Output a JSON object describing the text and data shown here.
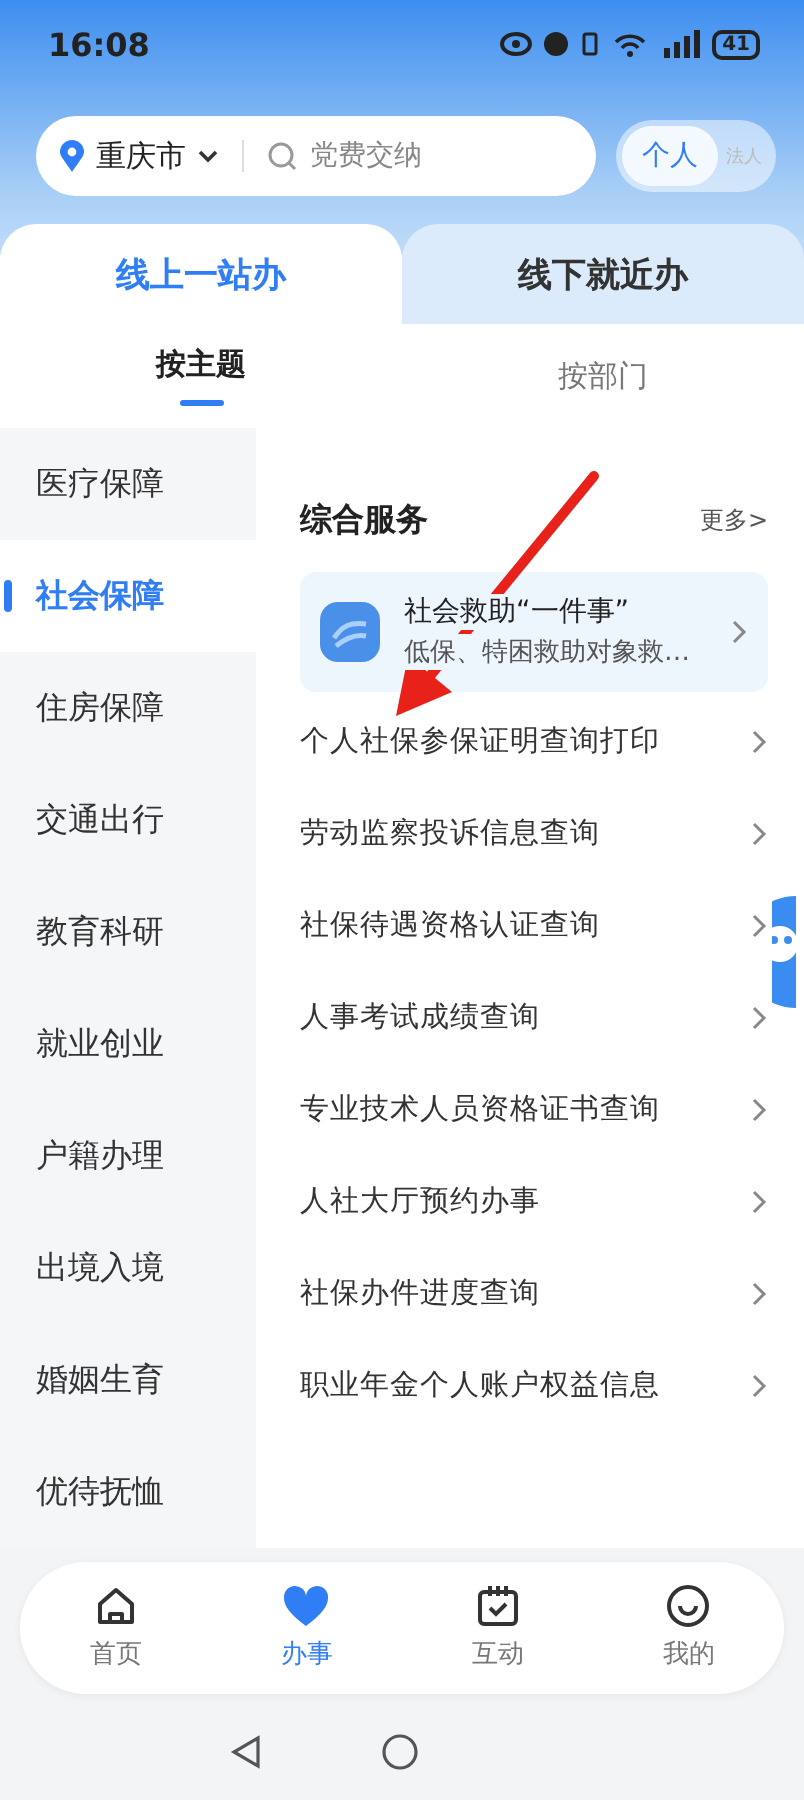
{
  "status_bar": {
    "time": "16:08",
    "battery": "41"
  },
  "search_bar": {
    "city": "重庆市",
    "placeholder": "党费交纳"
  },
  "identity_toggle": [
    {
      "label": "个人",
      "selected": true
    },
    {
      "label": "法人",
      "selected": false
    }
  ],
  "tabs": [
    {
      "label": "线上一站办",
      "selected": true
    },
    {
      "label": "线下就近办",
      "selected": false
    }
  ],
  "sub_tabs": [
    {
      "label": "按主题",
      "selected": true
    },
    {
      "label": "按部门",
      "selected": false
    }
  ],
  "sidebar": {
    "items": [
      {
        "label": "医疗保障",
        "selected": false
      },
      {
        "label": "社会保障",
        "selected": true
      },
      {
        "label": "住房保障",
        "selected": false
      },
      {
        "label": "交通出行",
        "selected": false
      },
      {
        "label": "教育科研",
        "selected": false
      },
      {
        "label": "就业创业",
        "selected": false
      },
      {
        "label": "户籍办理",
        "selected": false
      },
      {
        "label": "出境入境",
        "selected": false
      },
      {
        "label": "婚姻生育",
        "selected": false
      },
      {
        "label": "优待抚恤",
        "selected": false
      }
    ]
  },
  "section": {
    "title": "综合服务",
    "more": "更多>"
  },
  "feature_card": {
    "title": "社会救助“一件事”",
    "subtitle": "低保、特困救助对象救…"
  },
  "services": [
    {
      "label": "个人社保参保证明查询打印"
    },
    {
      "label": "劳动监察投诉信息查询"
    },
    {
      "label": "社保待遇资格认证查询"
    },
    {
      "label": "人事考试成绩查询"
    },
    {
      "label": "专业技术人员资格证书查询"
    },
    {
      "label": "人社大厅预约办事"
    },
    {
      "label": "社保办件进度查询"
    },
    {
      "label": "职业年金个人账户权益信息"
    }
  ],
  "bottom_nav": [
    {
      "label": "首页",
      "selected": false
    },
    {
      "label": "办事",
      "selected": true
    },
    {
      "label": "互动",
      "selected": false
    },
    {
      "label": "我的",
      "selected": false
    }
  ]
}
